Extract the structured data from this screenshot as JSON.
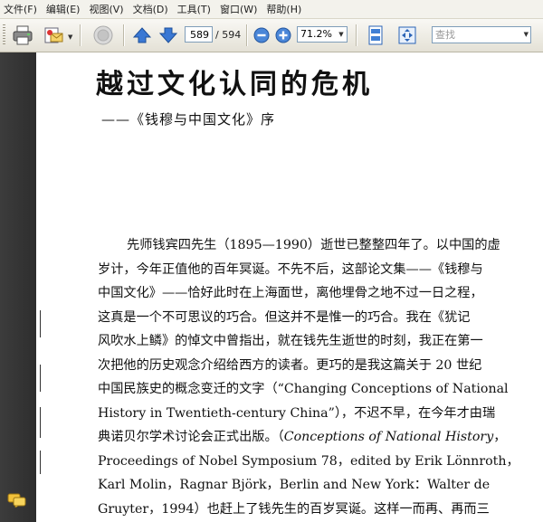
{
  "menu": {
    "items": [
      "文件(F)",
      "编辑(E)",
      "视图(V)",
      "文档(D)",
      "工具(T)",
      "窗口(W)",
      "帮助(H)"
    ]
  },
  "toolbar": {
    "current_page": "589",
    "total_pages": "/ 594",
    "zoom": "71.2%",
    "search_placeholder": "查找",
    "icons": [
      "print-icon",
      "email-icon",
      "hand-tool-icon",
      "previous-page-icon",
      "next-page-icon",
      "zoom-out-icon",
      "zoom-in-icon",
      "fit-page-icon",
      "fit-width-icon"
    ]
  },
  "colors": {
    "leftbar": "#333333",
    "accent_blue": "#2f6fc4",
    "page": "#ffffff"
  },
  "document": {
    "title": "越过文化认同的危机",
    "subtitle": "——《钱穆与中国文化》序",
    "lines": [
      "先师钱宾四先生（1895—1990）逝世已整整四年了。以中国的虚",
      "岁计，今年正值他的百年冥诞。不先不后，这部论文集——《钱穆与",
      "中国文化》——恰好此时在上海面世，离他埋骨之地不过一日之程，",
      "这真是一个不可思议的巧合。但这并不是惟一的巧合。我在《犹记",
      "风吹水上鳞》的悼文中曾指出，就在钱先生逝世的时刻，我正在第一",
      "次把他的历史观念介绍给西方的读者。更巧的是我这篇关于 20 世纪",
      "中国民族史的概念变迁的文字（“Changing Conceptions of National",
      "History in Twentieth-century China”），不迟不早，在今年才由瑞",
      "典诺贝尔学术讨论会正式出版。（",
      "Conceptions of National History",
      "，",
      "Proceedings of Nobel Symposium 78，edited by Erik Lönnroth，",
      "Karl Molin，Ragnar Björk，Berlin and New York：Walter de",
      "Gruyter，1994）也赶上了钱先生的百岁冥诞。这样一而再、再而三"
    ]
  }
}
